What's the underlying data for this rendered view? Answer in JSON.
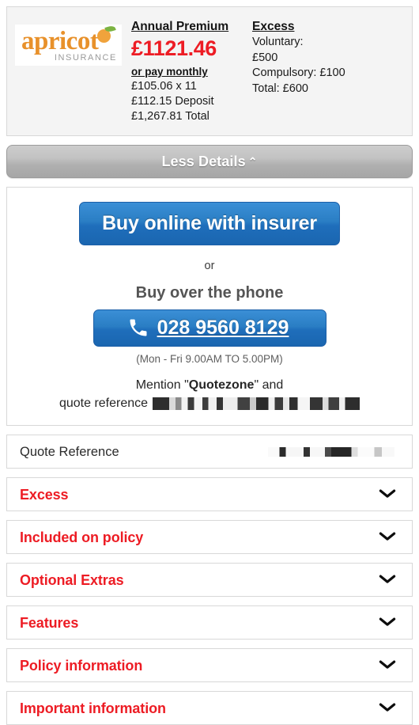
{
  "brand": {
    "name": "apricot",
    "subtitle": "INSURANCE",
    "accent_orange": "#e8912b",
    "accent_red": "#ed1c24",
    "accent_blue": "#1f6ebb"
  },
  "quote_summary": {
    "premium": {
      "heading": "Annual Premium",
      "amount": "£1121.46",
      "monthly_heading": "or pay monthly",
      "instalments": "£105.06 x 11",
      "deposit": "£112.15 Deposit",
      "total": "£1,267.81 Total"
    },
    "excess": {
      "heading": "Excess",
      "voluntary_label": "Voluntary:",
      "voluntary_value": "£500",
      "compulsory": "Compulsory: £100",
      "total": "Total: £600"
    }
  },
  "toggle": {
    "label": "Less Details",
    "chevron": "⌃",
    "icon_name": "chevron-up-icon"
  },
  "buy_panel": {
    "online_label": "Buy online with insurer",
    "or_label": "or",
    "phone_heading": "Buy over the phone",
    "phone_number": "028 9560 8129",
    "phone_icon": "phone-handset-icon",
    "phone_hours": "(Mon - Fri 9.00AM TO 5.00PM)",
    "mention_prefix": "Mention \"",
    "mention_brand": "Quotezone",
    "mention_suffix": "\" and",
    "reference_label": "quote reference",
    "reference_value_redacted": true
  },
  "quote_reference_row": {
    "label": "Quote Reference",
    "value_redacted": true
  },
  "accordions": [
    {
      "label": "Excess",
      "icon": "chevron-down-icon",
      "expanded": false
    },
    {
      "label": "Included on policy",
      "icon": "chevron-down-icon",
      "expanded": false
    },
    {
      "label": "Optional Extras",
      "icon": "chevron-down-icon",
      "expanded": false
    },
    {
      "label": "Features",
      "icon": "chevron-down-icon",
      "expanded": false
    },
    {
      "label": "Policy information",
      "icon": "chevron-down-icon",
      "expanded": false
    },
    {
      "label": "Important information",
      "icon": "chevron-down-icon",
      "expanded": false
    }
  ]
}
